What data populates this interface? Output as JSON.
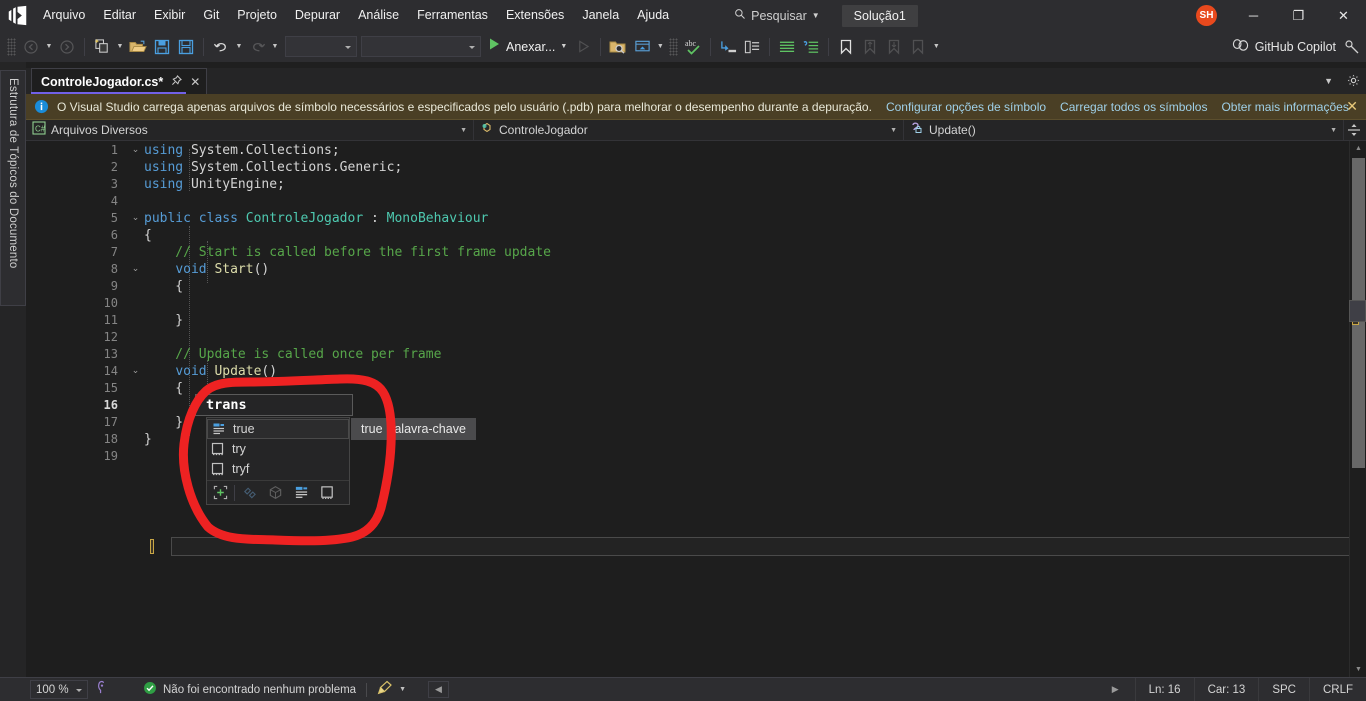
{
  "titlebar": {
    "logo_icon": "visual-studio-logo",
    "menus": [
      "Arquivo",
      "Editar",
      "Exibir",
      "Git",
      "Projeto",
      "Depurar",
      "Análise",
      "Ferramentas",
      "Extensões",
      "Janela",
      "Ajuda"
    ],
    "search_placeholder": "Pesquisar",
    "search_label": "Pesquisar",
    "solution_badge": "Solução1",
    "avatar_initials": "SH",
    "avatar_color": "#e8491d",
    "window_minimize": "─",
    "window_restore": "❐",
    "window_close": "✕"
  },
  "toolbar": {
    "run_label": "Anexar...",
    "copilot_label": "GitHub Copilot",
    "combo1_value": "",
    "combo2_value": ""
  },
  "leftdock": {
    "document_outline_label": "Estrutura de Tópicos do Documento"
  },
  "tabstrip": {
    "active_tab": "ControleJogador.cs*",
    "pin_icon": "pin-icon",
    "close_icon": "close-icon",
    "accent_color": "#7160e8",
    "chevron_icon": "chevron-down-icon",
    "settings_icon": "gear-icon"
  },
  "infobar": {
    "icon": "info-icon",
    "message": "O Visual Studio carrega apenas arquivos de símbolo necessários e especificados pelo usuário (.pdb) para melhorar o desempenho durante a depuração.",
    "links": [
      "Configurar opções de símbolo",
      "Carregar todos os símbolos",
      "Obter mais informações"
    ],
    "close": "✕",
    "bg_color": "#4a3f25"
  },
  "navbar": {
    "project_selector": "Arquivos Diversos",
    "project_icon": "csharp-file-icon",
    "type_selector": "ControleJogador",
    "type_icon": "class-icon",
    "member_selector": "Update()",
    "member_icon": "method-private-icon",
    "split_icon": "split-view-icon"
  },
  "editor": {
    "lines": [
      {
        "num": "1",
        "fold": "v",
        "text": "using System.Collections;",
        "tokens": [
          [
            "k",
            "using"
          ],
          [
            "p",
            " System.Collections;"
          ]
        ]
      },
      {
        "num": "2",
        "fold": "",
        "text": "using System.Collections.Generic;",
        "tokens": [
          [
            "k",
            "using"
          ],
          [
            "p",
            " System.Collections.Generic;"
          ]
        ]
      },
      {
        "num": "3",
        "fold": "",
        "text": "using UnityEngine;",
        "tokens": [
          [
            "k",
            "using"
          ],
          [
            "p",
            " UnityEngine;"
          ]
        ]
      },
      {
        "num": "4",
        "fold": "",
        "text": "",
        "tokens": []
      },
      {
        "num": "5",
        "fold": "v",
        "text": "public class ControleJogador : MonoBehaviour",
        "tokens": [
          [
            "k",
            "public class "
          ],
          [
            "ty",
            "ControleJogador"
          ],
          [
            "p",
            " : "
          ],
          [
            "ty",
            "MonoBehaviour"
          ]
        ]
      },
      {
        "num": "6",
        "fold": "",
        "text": "{",
        "tokens": [
          [
            "p",
            "{"
          ]
        ]
      },
      {
        "num": "7",
        "fold": "",
        "text": "    // Start is called before the first frame update",
        "tokens": [
          [
            "c",
            "    // Start is called before the first frame update"
          ]
        ]
      },
      {
        "num": "8",
        "fold": "v",
        "text": "    void Start()",
        "tokens": [
          [
            "p",
            "    "
          ],
          [
            "k",
            "void"
          ],
          [
            "p",
            " "
          ],
          [
            "m",
            "Start"
          ],
          [
            "p",
            "()"
          ]
        ]
      },
      {
        "num": "9",
        "fold": "",
        "text": "    {",
        "tokens": [
          [
            "p",
            "    {"
          ]
        ]
      },
      {
        "num": "10",
        "fold": "",
        "text": "",
        "tokens": []
      },
      {
        "num": "11",
        "fold": "",
        "text": "    }",
        "tokens": [
          [
            "p",
            "    }"
          ]
        ]
      },
      {
        "num": "12",
        "fold": "",
        "text": "",
        "tokens": []
      },
      {
        "num": "13",
        "fold": "",
        "text": "    // Update is called once per frame",
        "tokens": [
          [
            "c",
            "    // Update is called once per frame"
          ]
        ]
      },
      {
        "num": "14",
        "fold": "v",
        "text": "    void Update()",
        "tokens": [
          [
            "p",
            "    "
          ],
          [
            "k",
            "void"
          ],
          [
            "p",
            " "
          ],
          [
            "m",
            "Update"
          ],
          [
            "p",
            "()"
          ]
        ]
      },
      {
        "num": "15",
        "fold": "",
        "text": "    {",
        "tokens": [
          [
            "p",
            "    {"
          ]
        ]
      },
      {
        "num": "16",
        "fold": "",
        "text": "        trans",
        "tokens": []
      },
      {
        "num": "17",
        "fold": "",
        "text": "    }",
        "tokens": [
          [
            "p",
            "    }"
          ]
        ]
      },
      {
        "num": "18",
        "fold": "",
        "text": "}",
        "tokens": [
          [
            "p",
            "}"
          ]
        ]
      },
      {
        "num": "19",
        "fold": "",
        "text": "",
        "tokens": []
      }
    ],
    "current_line": "16"
  },
  "intellisense": {
    "typed_text": "trans",
    "items": [
      {
        "label": "true",
        "icon": "keyword-icon",
        "selected": true
      },
      {
        "label": "try",
        "icon": "snippet-icon",
        "selected": false
      },
      {
        "label": "tryf",
        "icon": "snippet-icon",
        "selected": false
      }
    ],
    "tooltip": "true Palavra-chave",
    "filters": [
      {
        "name": "expand-filter-icon",
        "enabled": true
      },
      {
        "name": "extension-filter-icon",
        "enabled": false
      },
      {
        "name": "module-filter-icon",
        "enabled": false
      },
      {
        "name": "keyword-filter-icon",
        "enabled": true
      },
      {
        "name": "snippet-filter-icon",
        "enabled": true
      }
    ]
  },
  "statusbar": {
    "zoom": "100 %",
    "accessibility_icon": "accessibility-icon",
    "status_icon": "check-circle-icon",
    "status_text": "Não foi encontrado nenhum problema",
    "broom_icon": "code-cleanup-icon",
    "line_label": "Ln: 16",
    "col_label": "Car: 13",
    "spaces_label": "SPC",
    "eol_label": "CRLF",
    "nav_left_icon": "chevron-left-icon",
    "nav_right_icon": "chevron-right-icon"
  }
}
